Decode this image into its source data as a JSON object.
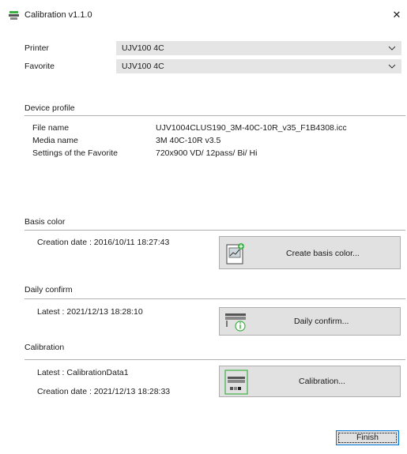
{
  "window": {
    "title": "Calibration  v1.1.0",
    "close_glyph": "✕"
  },
  "printer": {
    "label": "Printer",
    "value": "UJV100 4C"
  },
  "favorite": {
    "label": "Favorite",
    "value": "UJV100 4C"
  },
  "device_profile": {
    "title": "Device profile",
    "rows": [
      {
        "label": "File name",
        "value": "UJV1004CLUS190_3M-40C-10R_v35_F1B4308.icc"
      },
      {
        "label": "Media name",
        "value": "3M 40C-10R v3.5"
      },
      {
        "label": "Settings of the Favorite",
        "value": "720x900 VD/ 12pass/ Bi/ Hi"
      }
    ]
  },
  "basis_color": {
    "title": "Basis color",
    "creation_date": "Creation date : 2016/10/11 18:27:43",
    "button_label": "Create basis color...",
    "icon": "basis-color-icon"
  },
  "daily_confirm": {
    "title": "Daily confirm",
    "latest": "Latest : 2021/12/13 18:28:10",
    "button_label": "Daily confirm...",
    "icon": "daily-confirm-icon"
  },
  "calibration": {
    "title": "Calibration",
    "latest": "Latest : CalibrationData1",
    "creation_date": "Creation date : 2021/12/13 18:28:33",
    "button_label": "Calibration...",
    "icon": "calibration-icon"
  },
  "footer": {
    "finish_label": "Finish"
  },
  "colors": {
    "accent": "#0078d7",
    "button_bg": "#e1e1e1",
    "select_bg": "#e5e5e5",
    "icon_green": "#3cb043"
  }
}
